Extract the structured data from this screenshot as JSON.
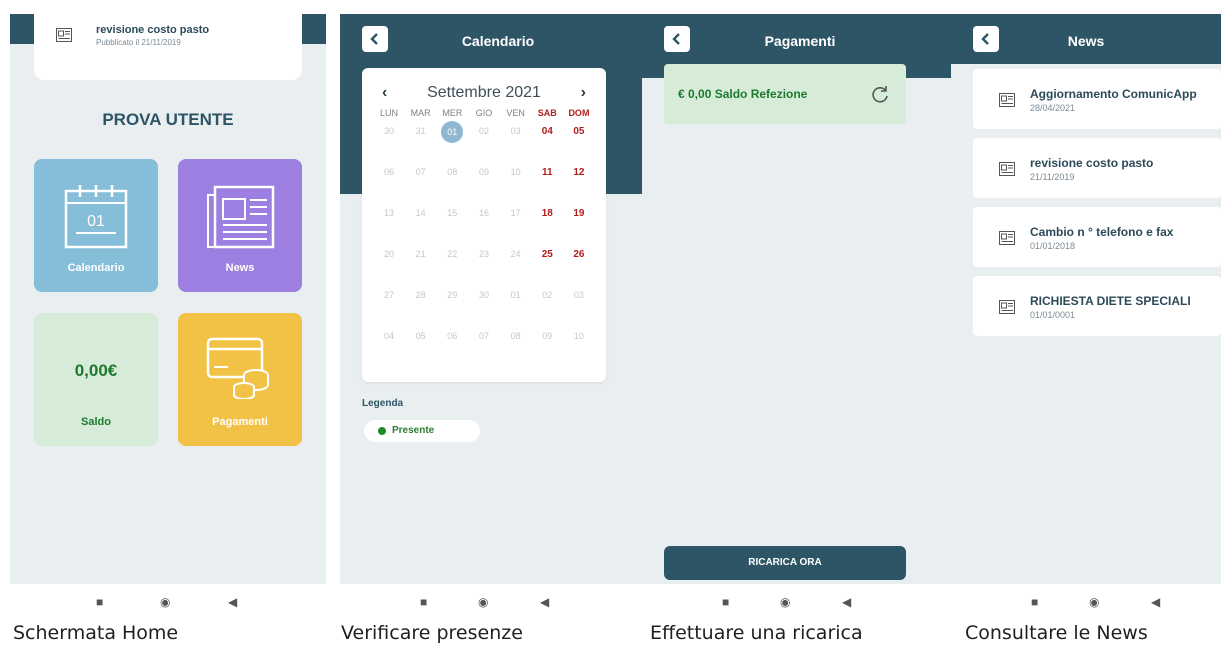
{
  "screens": [
    {
      "caption": "Schermata Home",
      "news_card": {
        "title": "revisione costo pasto",
        "subtitle": "Pubblicato il 21/11/2019"
      },
      "user_name": "PROVA UTENTE",
      "tiles": [
        {
          "label": "Calendario",
          "icon": "calendar-icon",
          "icon_text": "01",
          "color": "#86bdd9"
        },
        {
          "label": "News",
          "icon": "newspaper-icon",
          "color": "#9c7fe0"
        },
        {
          "label": "Saldo",
          "value": "0,00€",
          "color": "#d7ecd8"
        },
        {
          "label": "Pagamenti",
          "icon": "cards-coins-icon",
          "color": "#f1c246"
        }
      ]
    },
    {
      "caption": "Verificare presenze",
      "title": "Calendario",
      "month": "Settembre 2021",
      "weekdays": [
        "LUN",
        "MAR",
        "MER",
        "GIO",
        "VEN",
        "SAB",
        "DOM"
      ],
      "weeks": [
        [
          "30",
          "31",
          "01",
          "02",
          "03",
          "04",
          "05"
        ],
        [
          "06",
          "07",
          "08",
          "09",
          "10",
          "11",
          "12"
        ],
        [
          "13",
          "14",
          "15",
          "16",
          "17",
          "18",
          "19"
        ],
        [
          "20",
          "21",
          "22",
          "23",
          "24",
          "25",
          "26"
        ],
        [
          "27",
          "28",
          "29",
          "30",
          "01",
          "02",
          "03"
        ],
        [
          "04",
          "05",
          "06",
          "07",
          "08",
          "09",
          "10"
        ]
      ],
      "selected_day": "01",
      "legend_title": "Legenda",
      "legend_items": [
        {
          "label": "Presente",
          "color": "#1e8a2e"
        }
      ]
    },
    {
      "caption": "Effettuare una ricarica",
      "title": "Pagamenti",
      "saldo": "€ 0,00 Saldo Refezione",
      "button": "RICARICA ORA"
    },
    {
      "caption": "Consultare le News",
      "title": "News",
      "items": [
        {
          "title": "Aggiornamento ComunicApp",
          "date": "28/04/2021"
        },
        {
          "title": "revisione costo pasto",
          "date": "21/11/2019"
        },
        {
          "title": "Cambio n ° telefono e fax",
          "date": "01/01/2018"
        },
        {
          "title": "RICHIESTA DIETE SPECIALI",
          "date": "01/01/0001"
        }
      ]
    }
  ],
  "colors": {
    "header": "#2e5566",
    "background": "#e9eef0",
    "weekend": "#b11d1d"
  }
}
